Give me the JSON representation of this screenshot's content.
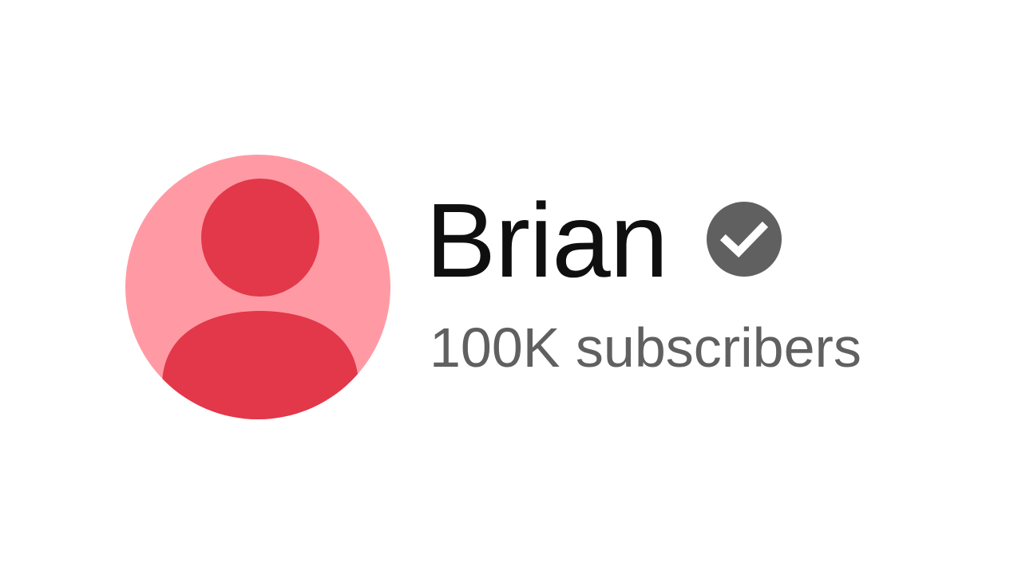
{
  "channel": {
    "name": "Brian",
    "subscriber_count": "100K subscribers",
    "verified": true
  },
  "avatar": {
    "icon": "default-avatar-person-icon",
    "background_color": "#ff9aa4",
    "figure_color": "#e2384a"
  },
  "badge": {
    "icon": "verified-check-icon",
    "color": "#606060"
  }
}
